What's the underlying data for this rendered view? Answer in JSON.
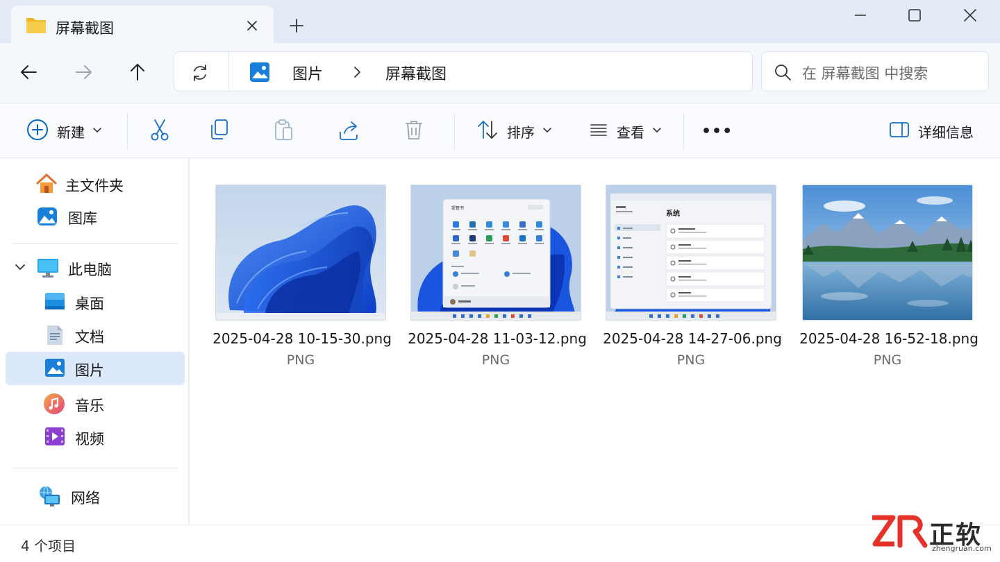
{
  "window": {
    "tab_title": "屏幕截图",
    "new_tab_symbol": "+"
  },
  "address": {
    "crumbs": [
      "图片",
      "屏幕截图"
    ],
    "search_placeholder": "在 屏幕截图 中搜索"
  },
  "toolbar": {
    "new_label": "新建",
    "sort_label": "排序",
    "view_label": "查看",
    "more_label": "•••",
    "details_label": "详细信息"
  },
  "sidebar": {
    "items": [
      {
        "label": "主文件夹",
        "icon": "home-icon"
      },
      {
        "label": "图库",
        "icon": "gallery-icon"
      },
      {
        "label": "此电脑",
        "icon": "this-pc-icon"
      },
      {
        "label": "桌面",
        "icon": "desktop-icon"
      },
      {
        "label": "文档",
        "icon": "documents-icon"
      },
      {
        "label": "图片",
        "icon": "pictures-icon",
        "selected": true
      },
      {
        "label": "音乐",
        "icon": "music-icon"
      },
      {
        "label": "视频",
        "icon": "videos-icon"
      },
      {
        "label": "网络",
        "icon": "network-icon"
      }
    ]
  },
  "files": [
    {
      "name": "2025-04-28 10-15-30.png",
      "type": "PNG",
      "thumb": "bloom-wallpaper"
    },
    {
      "name": "2025-04-28 11-03-12.png",
      "type": "PNG",
      "thumb": "start-menu"
    },
    {
      "name": "2025-04-28 14-27-06.png",
      "type": "PNG",
      "thumb": "settings-system"
    },
    {
      "name": "2025-04-28 16-52-18.png",
      "type": "PNG",
      "thumb": "mountain-lake"
    }
  ],
  "thumb_text": {
    "start_user": "提督书",
    "settings_title": "系统"
  },
  "status": {
    "item_count": "4 个项目"
  },
  "watermark": {
    "logo": "ZR",
    "name": "正软",
    "url": "zhengruan.com"
  },
  "colors": {
    "accent": "#0067c0",
    "selected_bg": "#dbe9fa",
    "folder": "#f5c542",
    "watermark_red": "#e5332a"
  }
}
